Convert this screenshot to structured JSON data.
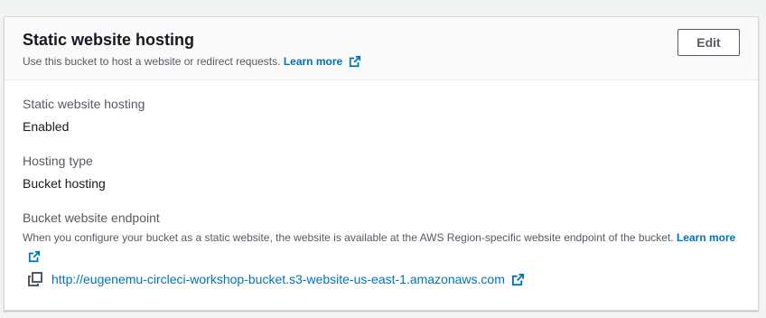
{
  "section": {
    "title": "Static website hosting",
    "description": "Use this bucket to host a website or redirect requests.",
    "learn_more": "Learn more",
    "edit_label": "Edit"
  },
  "fields": {
    "hosting": {
      "label": "Static website hosting",
      "value": "Enabled"
    },
    "type": {
      "label": "Hosting type",
      "value": "Bucket hosting"
    },
    "endpoint": {
      "label": "Bucket website endpoint",
      "help": "When you configure your bucket as a static website, the website is available at the AWS Region-specific website endpoint of the bucket.",
      "learn_more": "Learn more",
      "url": "http://eugenemu-circleci-workshop-bucket.s3-website-us-east-1.amazonaws.com"
    }
  },
  "colors": {
    "link": "#0073bb",
    "text": "#16191f",
    "secondary_text": "#545b64",
    "header_bg": "#fafafa",
    "border": "#d5dbdb"
  },
  "icons": [
    "external-link-icon",
    "copy-icon"
  ]
}
